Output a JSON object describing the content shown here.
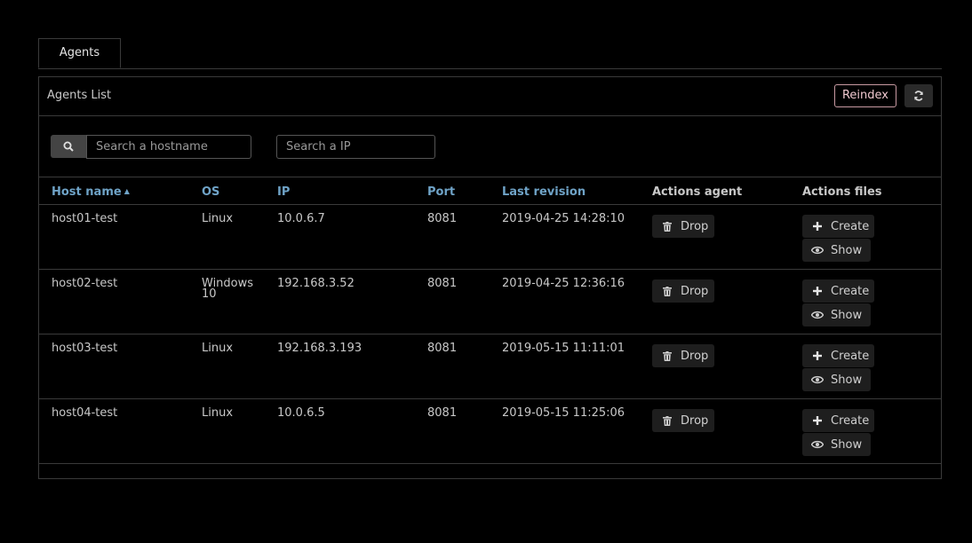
{
  "tabs": [
    {
      "label": "Agents"
    }
  ],
  "panel": {
    "title": "Agents List",
    "reindex_label": "Reindex",
    "refresh_icon": "refresh-icon"
  },
  "search": {
    "hostname_placeholder": "Search a hostname",
    "ip_placeholder": "Search a IP",
    "icon": "search-icon"
  },
  "table": {
    "columns": [
      "Host name",
      "OS",
      "IP",
      "Port",
      "Last revision",
      "Actions agent",
      "Actions files"
    ],
    "sort": {
      "column": "Host name",
      "direction": "asc"
    },
    "rows": [
      {
        "host": "host01-test",
        "os": "Linux",
        "ip": "10.0.6.7",
        "port": "8081",
        "revision": "2019-04-25 14:28:10"
      },
      {
        "host": "host02-test",
        "os": "Windows 10",
        "ip": "192.168.3.52",
        "port": "8081",
        "revision": "2019-04-25 12:36:16"
      },
      {
        "host": "host03-test",
        "os": "Linux",
        "ip": "192.168.3.193",
        "port": "8081",
        "revision": "2019-05-15 11:11:01"
      },
      {
        "host": "host04-test",
        "os": "Linux",
        "ip": "10.0.6.5",
        "port": "8081",
        "revision": "2019-05-15 11:25:06"
      }
    ],
    "actions": {
      "drop": "Drop",
      "create": "Create",
      "show": "Show"
    }
  },
  "colors": {
    "link": "#6fa3c7",
    "reindex_border": "#c89aa2",
    "background": "#000000"
  }
}
